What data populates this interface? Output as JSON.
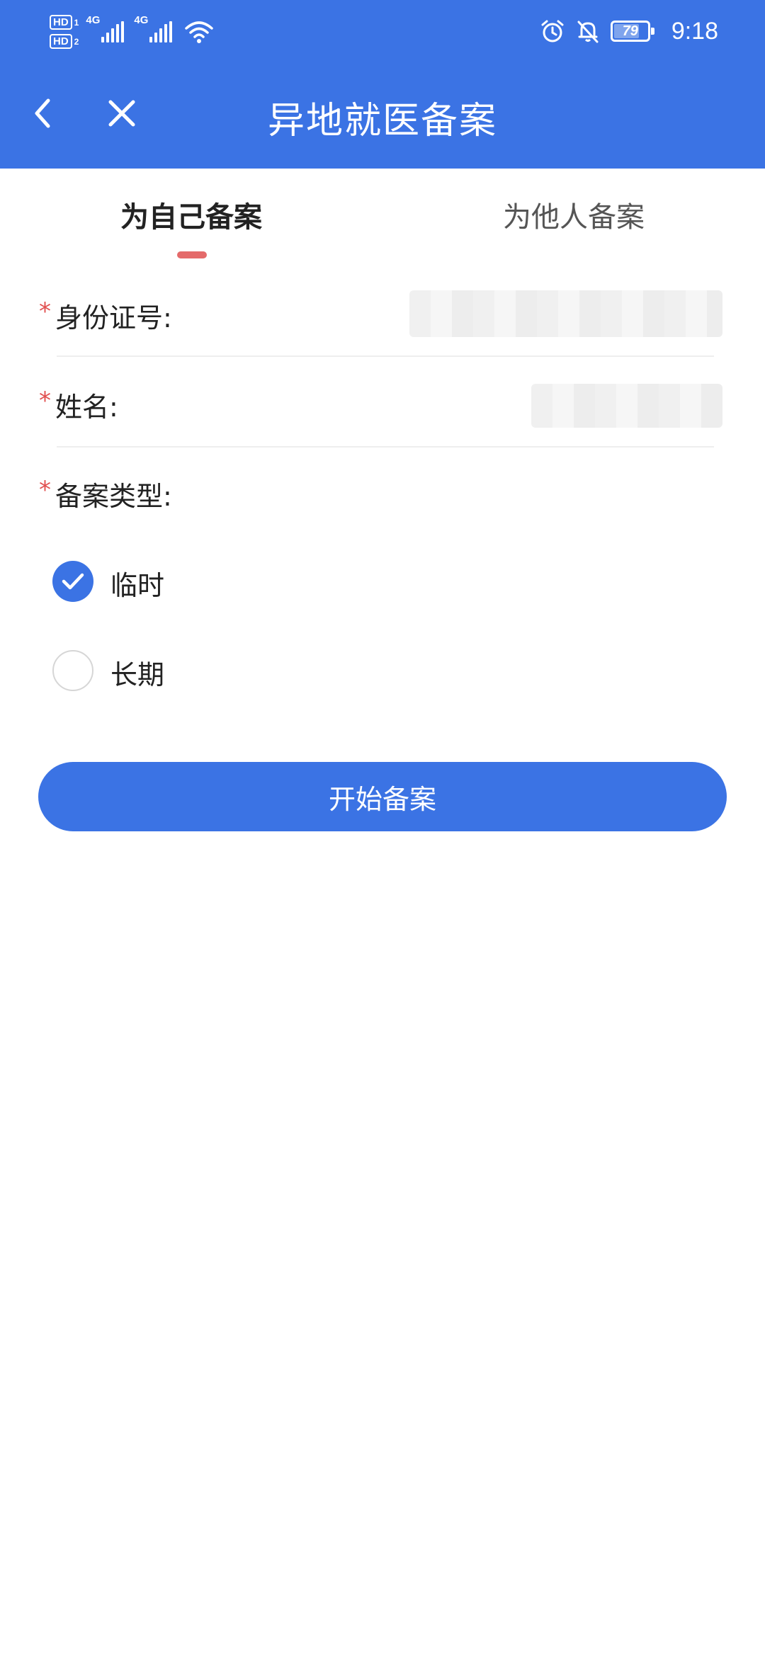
{
  "status_bar": {
    "hd_1": "HD",
    "hd_1_sub": "1",
    "hd_2": "HD",
    "hd_2_sub": "2",
    "net_1": "4G",
    "net_2": "4G",
    "battery_level": "79",
    "battery_fraction": 0.79,
    "time": "9:18",
    "icons": [
      "signal-icon",
      "wifi-icon",
      "alarm-icon",
      "bell-muted-icon",
      "battery-icon"
    ]
  },
  "nav": {
    "title": "异地就医备案",
    "back_icon": "back-arrow-icon",
    "close_icon": "close-icon"
  },
  "tabs": [
    {
      "label": "为自己备案",
      "active": true
    },
    {
      "label": "为他人备案",
      "active": false
    }
  ],
  "form": {
    "required_mark": "*",
    "id_number": {
      "label": "身份证号:",
      "value_masked": true
    },
    "name": {
      "label": "姓名:",
      "value_masked": true
    },
    "filing_type": {
      "label": "备案类型:",
      "options": [
        {
          "label": "临时",
          "checked": true
        },
        {
          "label": "长期",
          "checked": false
        }
      ]
    }
  },
  "submit": {
    "label": "开始备案"
  },
  "colors": {
    "primary": "#3b73e4",
    "required": "#e15151",
    "tab_indicator": "#e46a6a",
    "divider": "#eeeeee"
  }
}
